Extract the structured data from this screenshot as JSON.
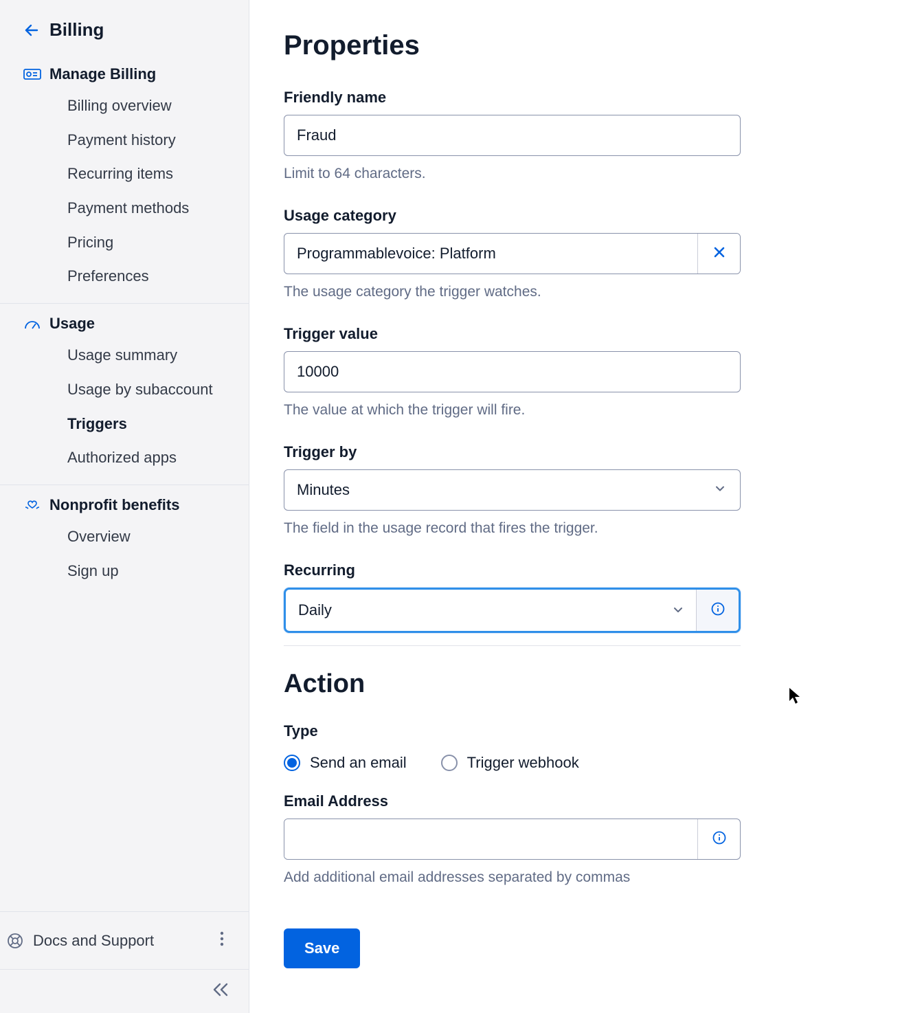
{
  "sidebar": {
    "back_label": "Billing",
    "sections": [
      {
        "title": "Manage Billing",
        "items": [
          "Billing overview",
          "Payment history",
          "Recurring items",
          "Payment methods",
          "Pricing",
          "Preferences"
        ],
        "active_index": -1
      },
      {
        "title": "Usage",
        "items": [
          "Usage summary",
          "Usage by subaccount",
          "Triggers",
          "Authorized apps"
        ],
        "active_index": 2
      },
      {
        "title": "Nonprofit benefits",
        "items": [
          "Overview",
          "Sign up"
        ],
        "active_index": -1
      }
    ],
    "footer": {
      "docs_label": "Docs and Support"
    }
  },
  "main": {
    "properties_heading": "Properties",
    "friendly_name": {
      "label": "Friendly name",
      "value": "Fraud",
      "help": "Limit to 64 characters."
    },
    "usage_category": {
      "label": "Usage category",
      "value": "Programmablevoice: Platform",
      "help": "The usage category the trigger watches."
    },
    "trigger_value": {
      "label": "Trigger value",
      "value": "10000",
      "help": "The value at which the trigger will fire."
    },
    "trigger_by": {
      "label": "Trigger by",
      "value": "Minutes",
      "help": "The field in the usage record that fires the trigger."
    },
    "recurring": {
      "label": "Recurring",
      "value": "Daily"
    },
    "action_heading": "Action",
    "action_type": {
      "label": "Type",
      "options": [
        "Send an email",
        "Trigger webhook"
      ],
      "selected_index": 0
    },
    "email": {
      "label": "Email Address",
      "value": "",
      "help": "Add additional email addresses separated by commas"
    },
    "save_label": "Save"
  }
}
